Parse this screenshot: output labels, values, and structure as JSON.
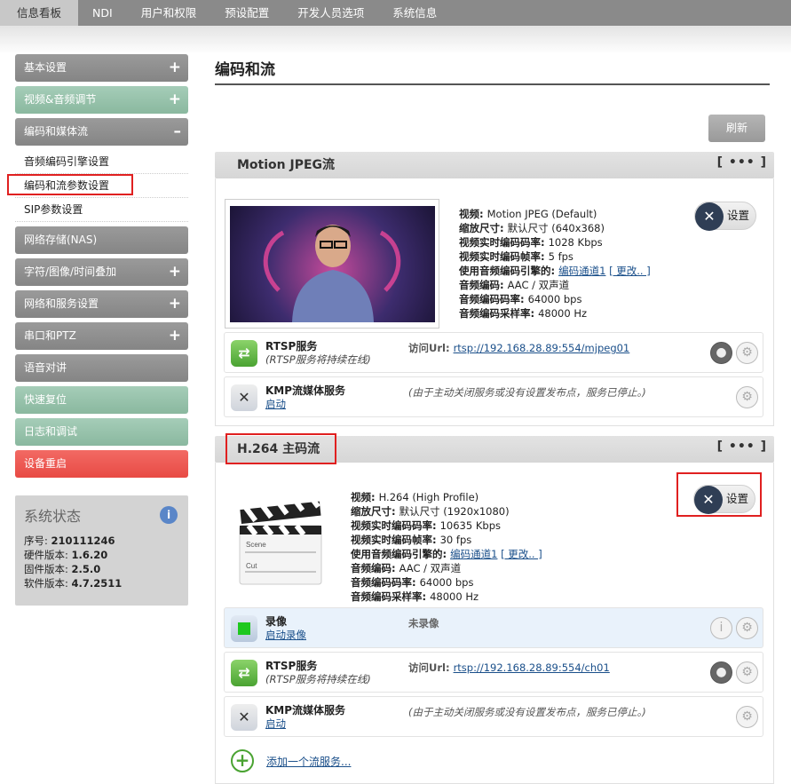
{
  "topnav": [
    "信息看板",
    "NDI",
    "用户和权限",
    "预设配置",
    "开发人员选项",
    "系统信息"
  ],
  "sidebar": {
    "items": [
      {
        "label": "基本设置",
        "sign": "+"
      },
      {
        "label": "视频&音频调节",
        "sign": "+"
      },
      {
        "label": "编码和媒体流",
        "sign": "–"
      },
      {
        "label": "网络存储(NAS)",
        "sign": ""
      },
      {
        "label": "字符/图像/时间叠加",
        "sign": "+"
      },
      {
        "label": "网络和服务设置",
        "sign": "+"
      },
      {
        "label": "串口和PTZ",
        "sign": "+"
      },
      {
        "label": "语音对讲",
        "sign": ""
      },
      {
        "label": "快速复位",
        "sign": ""
      },
      {
        "label": "日志和调试",
        "sign": ""
      },
      {
        "label": "设备重启",
        "sign": ""
      }
    ],
    "subitems": [
      "音频编码引擎设置",
      "编码和流参数设置",
      "SIP参数设置"
    ]
  },
  "status": {
    "title": "系统状态",
    "rows": [
      {
        "k": "序号: ",
        "v": "210111246"
      },
      {
        "k": "硬件版本: ",
        "v": "1.6.20"
      },
      {
        "k": "固件版本: ",
        "v": "2.5.0"
      },
      {
        "k": "软件版本: ",
        "v": "4.7.2511"
      }
    ]
  },
  "main": {
    "title": "编码和流",
    "refresh": "刷新",
    "more": "[ ••• ]",
    "settings": "设置",
    "stream1": {
      "title": "Motion JPEG流",
      "info": [
        {
          "k": "视频: ",
          "v": "Motion JPEG (Default)"
        },
        {
          "k": "缩放尺寸: ",
          "v": "默认尺寸 (640x368)"
        },
        {
          "k": "视频实时编码码率: ",
          "v": "1028 Kbps"
        },
        {
          "k": "视频实时编码帧率: ",
          "v": "5 fps"
        },
        {
          "k": "使用音频编码引擎的: ",
          "v": "编码通道1",
          "link2": "[ 更改.. ]"
        },
        {
          "k": "音频编码: ",
          "v": "AAC / 双声道"
        },
        {
          "k": "音频编码码率: ",
          "v": "64000 bps"
        },
        {
          "k": "音频编码采样率: ",
          "v": "48000 Hz"
        }
      ],
      "rtsp": {
        "name": "RTSP服务",
        "desc": "(RTSP服务将持续在线)",
        "url_label": "访问Url: ",
        "url": "rtsp://192.168.28.89:554/mjpeg01"
      },
      "kmp": {
        "name": "KMP流媒体服务",
        "link": "启动",
        "msg": "(由于主动关闭服务或没有设置发布点，服务已停止。)"
      }
    },
    "stream2": {
      "title": "H.264 主码流",
      "info": [
        {
          "k": "视频: ",
          "v": "H.264 (High Profile)"
        },
        {
          "k": "缩放尺寸: ",
          "v": "默认尺寸 (1920x1080)"
        },
        {
          "k": "视频实时编码码率: ",
          "v": "10635 Kbps"
        },
        {
          "k": "视频实时编码帧率: ",
          "v": "30 fps"
        },
        {
          "k": "使用音频编码引擎的: ",
          "v": "编码通道1",
          "link2": "[ 更改.. ]"
        },
        {
          "k": "音频编码: ",
          "v": "AAC / 双声道"
        },
        {
          "k": "音频编码码率: ",
          "v": "64000 bps"
        },
        {
          "k": "音频编码采样率: ",
          "v": "48000 Hz"
        }
      ],
      "record": {
        "name": "录像",
        "link": "启动录像",
        "state": "未录像"
      },
      "rtsp": {
        "name": "RTSP服务",
        "desc": "(RTSP服务将持续在线)",
        "url_label": "访问Url: ",
        "url": "rtsp://192.168.28.89:554/ch01"
      },
      "kmp": {
        "name": "KMP流媒体服务",
        "link": "启动",
        "msg": "(由于主动关闭服务或没有设置发布点，服务已停止。)"
      }
    },
    "add_service": "添加一个流服务...",
    "clapper": {
      "scene": "Scene",
      "cut": "Cut"
    }
  }
}
